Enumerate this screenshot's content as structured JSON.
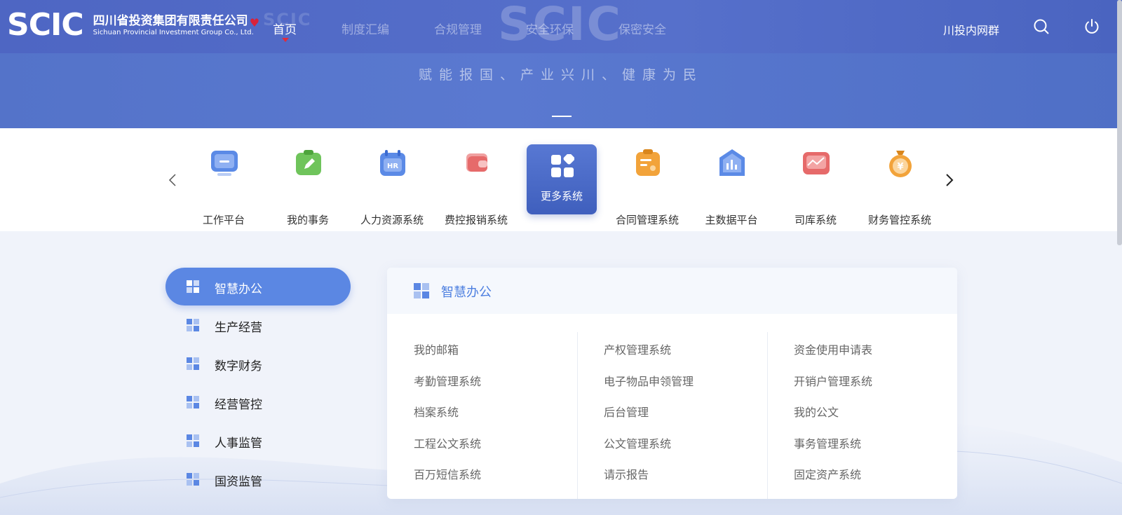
{
  "header": {
    "logo_mark": "SCIC",
    "logo_cn": "四川省投资集团有限责任公司",
    "logo_en": "Sichuan Provincial Investment Group Co., Ltd.",
    "nav": [
      "首页",
      "制度汇编",
      "合规管理",
      "安全环保",
      "保密安全"
    ],
    "active_nav": 0,
    "right_link": "川投内网群",
    "slogan": "赋能报国、产业兴川、健康为民"
  },
  "apps": [
    {
      "label": "工作平台",
      "icon": "monitor-icon",
      "color": "#5b8ae6"
    },
    {
      "label": "我的事务",
      "icon": "clipboard-edit-icon",
      "color": "#6fc45b"
    },
    {
      "label": "人力资源系统",
      "icon": "hr-calendar-icon",
      "color": "#5b8ae6"
    },
    {
      "label": "费控报销系统",
      "icon": "wallet-icon",
      "color": "#e66a6a"
    },
    {
      "label": "更多系统",
      "icon": "grid-more-icon",
      "color": "#ffffff"
    },
    {
      "label": "合同管理系统",
      "icon": "contract-icon",
      "color": "#f2a33a"
    },
    {
      "label": "主数据平台",
      "icon": "data-house-icon",
      "color": "#5b8ae6"
    },
    {
      "label": "司库系统",
      "icon": "trend-card-icon",
      "color": "#e66a6a"
    },
    {
      "label": "财务管控系统",
      "icon": "money-bag-icon",
      "color": "#f2a33a"
    }
  ],
  "sidebar": {
    "items": [
      "智慧办公",
      "生产经营",
      "数字财务",
      "经营管控",
      "人事监管",
      "国资监管"
    ],
    "active": 0
  },
  "panel": {
    "title": "智慧办公",
    "columns": [
      [
        "我的邮箱",
        "考勤管理系统",
        "档案系统",
        "工程公文系统",
        "百万短信系统"
      ],
      [
        "产权管理系统",
        "电子物品申领管理",
        "后台管理",
        "公文管理系统",
        "请示报告"
      ],
      [
        "资金使用申请表",
        "开销户管理系统",
        "我的公文",
        "事务管理系统",
        "固定资产系统"
      ]
    ]
  },
  "colors": {
    "primary": "#5b87e3",
    "header_blue": "#5670cb",
    "nav_caret": "#e02b3c"
  }
}
